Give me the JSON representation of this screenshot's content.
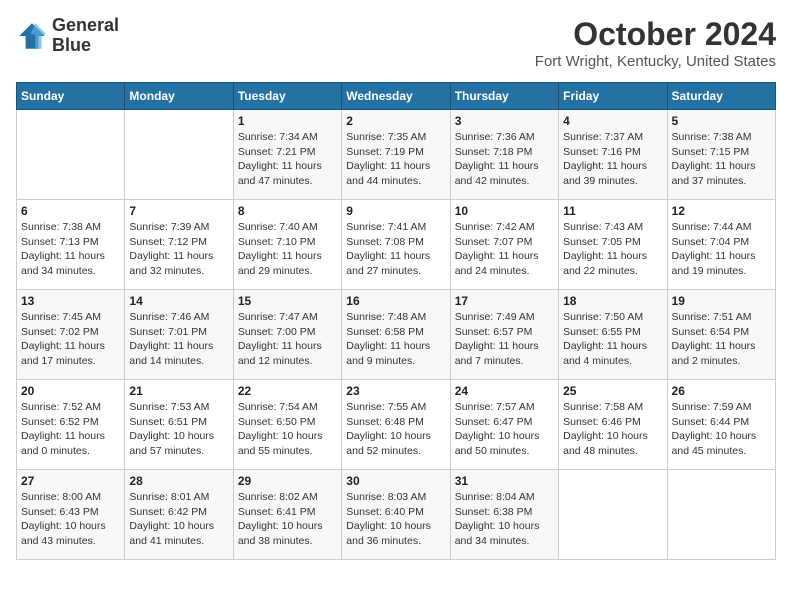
{
  "header": {
    "logo_line1": "General",
    "logo_line2": "Blue",
    "month": "October 2024",
    "location": "Fort Wright, Kentucky, United States"
  },
  "days_of_week": [
    "Sunday",
    "Monday",
    "Tuesday",
    "Wednesday",
    "Thursday",
    "Friday",
    "Saturday"
  ],
  "weeks": [
    [
      {
        "day": "",
        "info": ""
      },
      {
        "day": "",
        "info": ""
      },
      {
        "day": "1",
        "info": "Sunrise: 7:34 AM\nSunset: 7:21 PM\nDaylight: 11 hours and 47 minutes."
      },
      {
        "day": "2",
        "info": "Sunrise: 7:35 AM\nSunset: 7:19 PM\nDaylight: 11 hours and 44 minutes."
      },
      {
        "day": "3",
        "info": "Sunrise: 7:36 AM\nSunset: 7:18 PM\nDaylight: 11 hours and 42 minutes."
      },
      {
        "day": "4",
        "info": "Sunrise: 7:37 AM\nSunset: 7:16 PM\nDaylight: 11 hours and 39 minutes."
      },
      {
        "day": "5",
        "info": "Sunrise: 7:38 AM\nSunset: 7:15 PM\nDaylight: 11 hours and 37 minutes."
      }
    ],
    [
      {
        "day": "6",
        "info": "Sunrise: 7:38 AM\nSunset: 7:13 PM\nDaylight: 11 hours and 34 minutes."
      },
      {
        "day": "7",
        "info": "Sunrise: 7:39 AM\nSunset: 7:12 PM\nDaylight: 11 hours and 32 minutes."
      },
      {
        "day": "8",
        "info": "Sunrise: 7:40 AM\nSunset: 7:10 PM\nDaylight: 11 hours and 29 minutes."
      },
      {
        "day": "9",
        "info": "Sunrise: 7:41 AM\nSunset: 7:08 PM\nDaylight: 11 hours and 27 minutes."
      },
      {
        "day": "10",
        "info": "Sunrise: 7:42 AM\nSunset: 7:07 PM\nDaylight: 11 hours and 24 minutes."
      },
      {
        "day": "11",
        "info": "Sunrise: 7:43 AM\nSunset: 7:05 PM\nDaylight: 11 hours and 22 minutes."
      },
      {
        "day": "12",
        "info": "Sunrise: 7:44 AM\nSunset: 7:04 PM\nDaylight: 11 hours and 19 minutes."
      }
    ],
    [
      {
        "day": "13",
        "info": "Sunrise: 7:45 AM\nSunset: 7:02 PM\nDaylight: 11 hours and 17 minutes."
      },
      {
        "day": "14",
        "info": "Sunrise: 7:46 AM\nSunset: 7:01 PM\nDaylight: 11 hours and 14 minutes."
      },
      {
        "day": "15",
        "info": "Sunrise: 7:47 AM\nSunset: 7:00 PM\nDaylight: 11 hours and 12 minutes."
      },
      {
        "day": "16",
        "info": "Sunrise: 7:48 AM\nSunset: 6:58 PM\nDaylight: 11 hours and 9 minutes."
      },
      {
        "day": "17",
        "info": "Sunrise: 7:49 AM\nSunset: 6:57 PM\nDaylight: 11 hours and 7 minutes."
      },
      {
        "day": "18",
        "info": "Sunrise: 7:50 AM\nSunset: 6:55 PM\nDaylight: 11 hours and 4 minutes."
      },
      {
        "day": "19",
        "info": "Sunrise: 7:51 AM\nSunset: 6:54 PM\nDaylight: 11 hours and 2 minutes."
      }
    ],
    [
      {
        "day": "20",
        "info": "Sunrise: 7:52 AM\nSunset: 6:52 PM\nDaylight: 11 hours and 0 minutes."
      },
      {
        "day": "21",
        "info": "Sunrise: 7:53 AM\nSunset: 6:51 PM\nDaylight: 10 hours and 57 minutes."
      },
      {
        "day": "22",
        "info": "Sunrise: 7:54 AM\nSunset: 6:50 PM\nDaylight: 10 hours and 55 minutes."
      },
      {
        "day": "23",
        "info": "Sunrise: 7:55 AM\nSunset: 6:48 PM\nDaylight: 10 hours and 52 minutes."
      },
      {
        "day": "24",
        "info": "Sunrise: 7:57 AM\nSunset: 6:47 PM\nDaylight: 10 hours and 50 minutes."
      },
      {
        "day": "25",
        "info": "Sunrise: 7:58 AM\nSunset: 6:46 PM\nDaylight: 10 hours and 48 minutes."
      },
      {
        "day": "26",
        "info": "Sunrise: 7:59 AM\nSunset: 6:44 PM\nDaylight: 10 hours and 45 minutes."
      }
    ],
    [
      {
        "day": "27",
        "info": "Sunrise: 8:00 AM\nSunset: 6:43 PM\nDaylight: 10 hours and 43 minutes."
      },
      {
        "day": "28",
        "info": "Sunrise: 8:01 AM\nSunset: 6:42 PM\nDaylight: 10 hours and 41 minutes."
      },
      {
        "day": "29",
        "info": "Sunrise: 8:02 AM\nSunset: 6:41 PM\nDaylight: 10 hours and 38 minutes."
      },
      {
        "day": "30",
        "info": "Sunrise: 8:03 AM\nSunset: 6:40 PM\nDaylight: 10 hours and 36 minutes."
      },
      {
        "day": "31",
        "info": "Sunrise: 8:04 AM\nSunset: 6:38 PM\nDaylight: 10 hours and 34 minutes."
      },
      {
        "day": "",
        "info": ""
      },
      {
        "day": "",
        "info": ""
      }
    ]
  ]
}
